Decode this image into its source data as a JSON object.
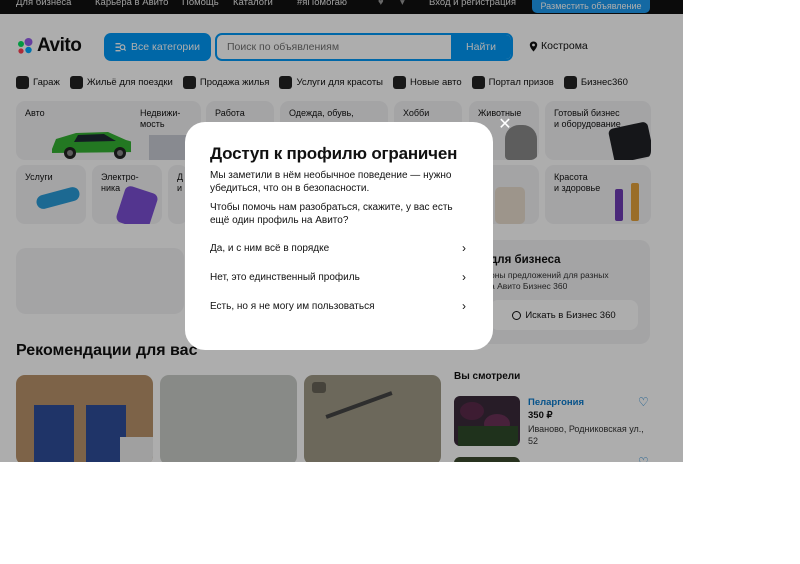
{
  "topbar": {
    "links": [
      "Для бизнеса",
      "Карьера в Авито",
      "Помощь",
      "Каталоги",
      "#яПомогаю"
    ],
    "login": "Вход и регистрация",
    "post_ad": "Разместить объявление"
  },
  "header": {
    "logo": "Avito",
    "categories_button": "Все категории",
    "search_placeholder": "Поиск по объявлениям",
    "search_value": "",
    "find_button": "Найти",
    "location": "Кострома"
  },
  "quick_links": [
    {
      "label": "Гараж",
      "icon": "car-icon"
    },
    {
      "label": "Жильё для поездки",
      "icon": "bed-icon"
    },
    {
      "label": "Продажа жилья",
      "icon": "key-icon"
    },
    {
      "label": "Услуги для красоты",
      "icon": "scissors-icon"
    },
    {
      "label": "Новые авто",
      "icon": "new-car-icon"
    },
    {
      "label": "Портал призов",
      "icon": "gift-icon"
    },
    {
      "label": "Бизнес360",
      "icon": "business-icon"
    }
  ],
  "category_tiles": {
    "row1": [
      "Авто",
      "Недвижи-\nмость",
      "Работа",
      "Одежда, обувь,",
      "Хобби",
      "Животные",
      "Готовый бизнес\nи оборудование"
    ],
    "row2": [
      "Услуги",
      "Электро-\nника",
      "Д\nи",
      "Красота\nи здоровье"
    ]
  },
  "business": {
    "title": "для бизнеса",
    "text": "оны предложений для разных\nа Авито Бизнес 360",
    "button": "Искать в Бизнес 360"
  },
  "recommendations": {
    "title": "Рекомендации для вас"
  },
  "viewed": {
    "title": "Вы смотрели",
    "item_name": "Пеларгония",
    "item_price": "350 ₽",
    "item_address": "Иваново, Родниковская ул., 52"
  },
  "modal": {
    "title": "Доступ к профилю ограничен",
    "text1": "Мы заметили в нём необычное поведение — нужно убедиться, что он в безопасности.",
    "text2": "Чтобы помочь нам разобраться, скажите, у вас есть ещё один профиль на Авито?",
    "options": [
      "Да, и с ним всё в порядке",
      "Нет, это единственный профиль",
      "Есть, но я не могу им пользоваться"
    ]
  },
  "colors": {
    "accent": "#0099f7",
    "link": "#0a7acc",
    "tile_bg": "#f2f2f4"
  }
}
